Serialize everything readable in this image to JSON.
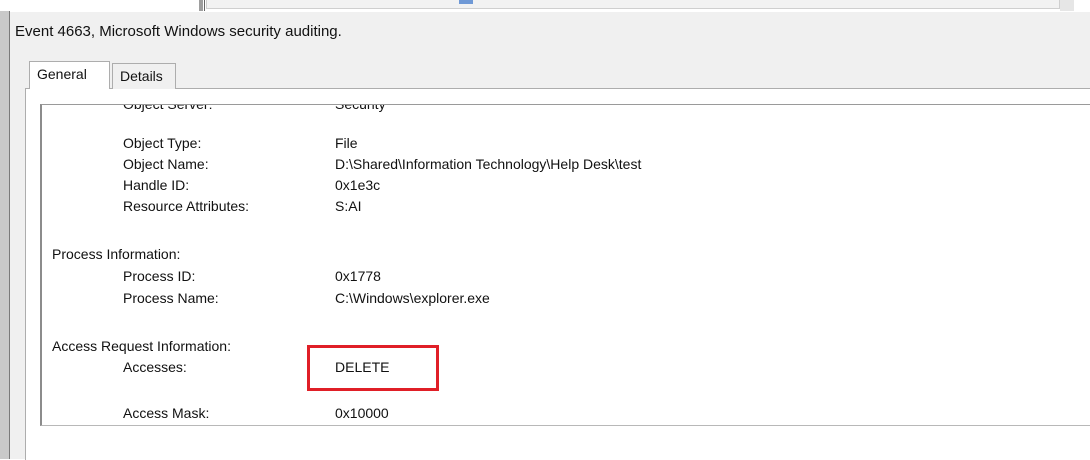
{
  "dialog": {
    "title": "Event 4663, Microsoft Windows security auditing.",
    "tabs": [
      "General",
      "Details"
    ]
  },
  "event_description": {
    "object_fields": [
      {
        "label": "Object Server:",
        "value": "Security"
      },
      {
        "label": "Object Type:",
        "value": "File"
      },
      {
        "label": "Object Name:",
        "value": "D:\\Shared\\Information Technology\\Help Desk\\test"
      },
      {
        "label": "Handle ID:",
        "value": "0x1e3c"
      },
      {
        "label": "Resource Attributes:",
        "value": "S:AI"
      }
    ],
    "process_section": {
      "heading": "Process Information:",
      "fields": [
        {
          "label": "Process ID:",
          "value": "0x1778"
        },
        {
          "label": "Process Name:",
          "value": "C:\\Windows\\explorer.exe"
        }
      ]
    },
    "access_section": {
      "heading": "Access Request Information:",
      "fields": [
        {
          "label": "Accesses:",
          "value": "DELETE"
        },
        {
          "label": "Access Mask:",
          "value": "0x10000"
        }
      ]
    }
  },
  "annotation": {
    "highlight_color": "#e01f27"
  }
}
